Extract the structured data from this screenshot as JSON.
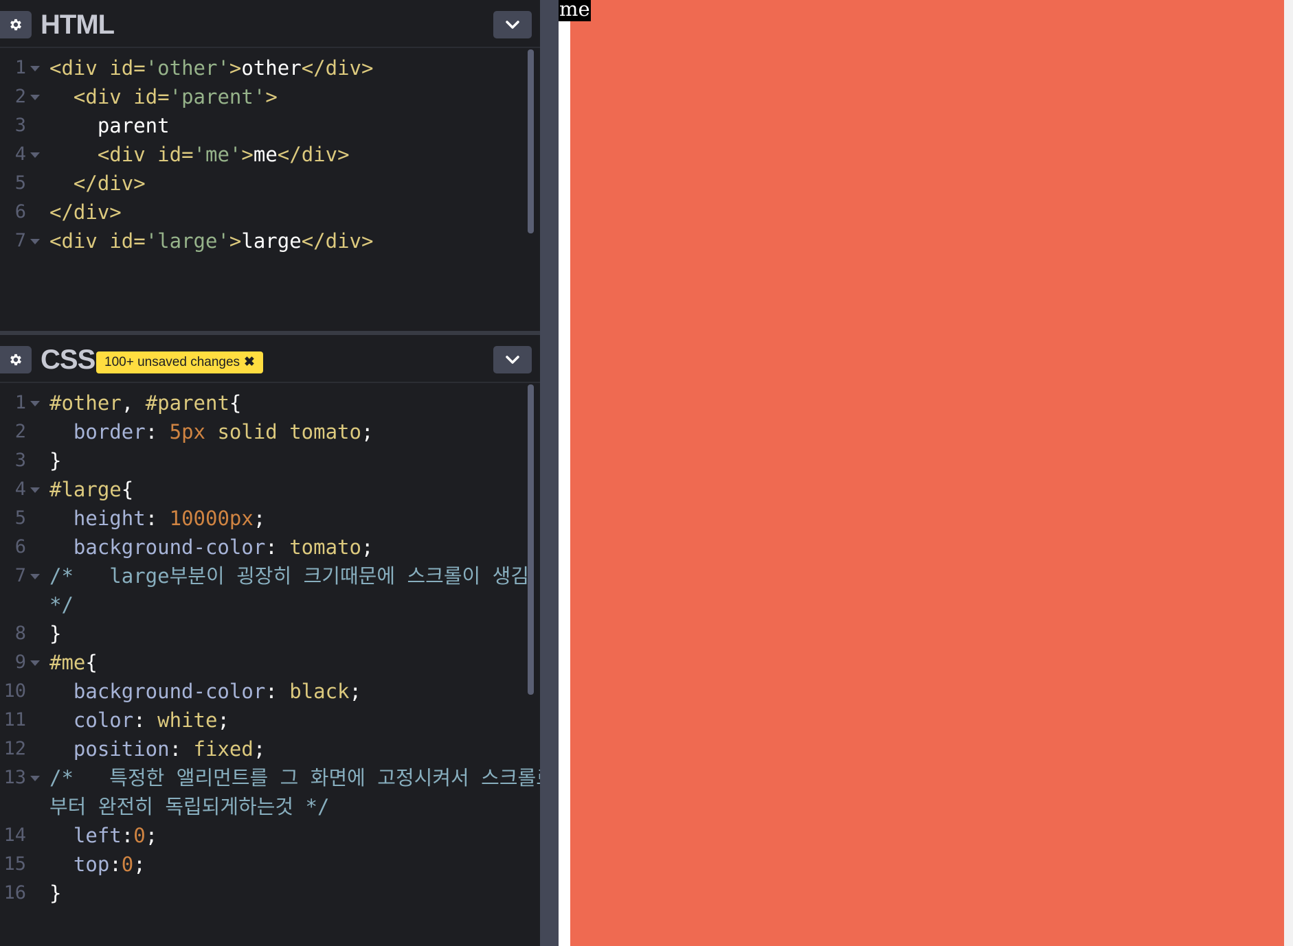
{
  "html_editor": {
    "title": "HTML",
    "settings_icon": "gear-icon",
    "collapse_icon": "chevron-down-icon",
    "lines": [
      {
        "n": "1",
        "fold": true,
        "indent": "",
        "tokens": [
          {
            "c": "tag",
            "t": "<div "
          },
          {
            "c": "attr",
            "t": "id="
          },
          {
            "c": "str",
            "t": "'other'"
          },
          {
            "c": "tag",
            "t": ">"
          },
          {
            "c": "txt",
            "t": "other"
          },
          {
            "c": "tag",
            "t": "</div>"
          }
        ]
      },
      {
        "n": "2",
        "fold": true,
        "indent": "  ",
        "tokens": [
          {
            "c": "tag",
            "t": "<div "
          },
          {
            "c": "attr",
            "t": "id="
          },
          {
            "c": "str",
            "t": "'parent'"
          },
          {
            "c": "tag",
            "t": ">"
          }
        ]
      },
      {
        "n": "3",
        "fold": false,
        "indent": "    ",
        "tokens": [
          {
            "c": "txt",
            "t": "parent"
          }
        ]
      },
      {
        "n": "4",
        "fold": true,
        "indent": "    ",
        "tokens": [
          {
            "c": "tag",
            "t": "<div "
          },
          {
            "c": "attr",
            "t": "id="
          },
          {
            "c": "str",
            "t": "'me'"
          },
          {
            "c": "tag",
            "t": ">"
          },
          {
            "c": "txt",
            "t": "me"
          },
          {
            "c": "tag",
            "t": "</div>"
          }
        ]
      },
      {
        "n": "5",
        "fold": false,
        "indent": "  ",
        "tokens": [
          {
            "c": "tag",
            "t": "</div>"
          }
        ]
      },
      {
        "n": "6",
        "fold": false,
        "indent": "",
        "tokens": [
          {
            "c": "tag",
            "t": "</div>"
          }
        ]
      },
      {
        "n": "7",
        "fold": true,
        "indent": "",
        "tokens": [
          {
            "c": "tag",
            "t": "<div "
          },
          {
            "c": "attr",
            "t": "id="
          },
          {
            "c": "str",
            "t": "'large'"
          },
          {
            "c": "tag",
            "t": ">"
          },
          {
            "c": "txt",
            "t": "large"
          },
          {
            "c": "tag",
            "t": "</div>"
          }
        ]
      }
    ]
  },
  "css_editor": {
    "title": "CSS",
    "settings_icon": "gear-icon",
    "collapse_icon": "chevron-down-icon",
    "badge_label": "100+ unsaved changes",
    "badge_icon": "close-icon",
    "lines": [
      {
        "n": "1",
        "fold": true,
        "indent": "",
        "tokens": [
          {
            "c": "sel",
            "t": "#other"
          },
          {
            "c": "punc",
            "t": ", "
          },
          {
            "c": "sel",
            "t": "#parent"
          },
          {
            "c": "punc",
            "t": "{"
          }
        ]
      },
      {
        "n": "2",
        "fold": false,
        "indent": "  ",
        "tokens": [
          {
            "c": "prop",
            "t": "border"
          },
          {
            "c": "punc",
            "t": ": "
          },
          {
            "c": "num",
            "t": "5px"
          },
          {
            "c": "val",
            "t": " solid tomato"
          },
          {
            "c": "punc",
            "t": ";"
          }
        ]
      },
      {
        "n": "3",
        "fold": false,
        "indent": "",
        "tokens": [
          {
            "c": "punc",
            "t": "}"
          }
        ]
      },
      {
        "n": "4",
        "fold": true,
        "indent": "",
        "tokens": [
          {
            "c": "sel",
            "t": "#large"
          },
          {
            "c": "punc",
            "t": "{"
          }
        ]
      },
      {
        "n": "5",
        "fold": false,
        "indent": "  ",
        "tokens": [
          {
            "c": "prop",
            "t": "height"
          },
          {
            "c": "punc",
            "t": ": "
          },
          {
            "c": "num",
            "t": "10000px"
          },
          {
            "c": "punc",
            "t": ";"
          }
        ]
      },
      {
        "n": "6",
        "fold": false,
        "indent": "  ",
        "tokens": [
          {
            "c": "prop",
            "t": "background-color"
          },
          {
            "c": "punc",
            "t": ": "
          },
          {
            "c": "val",
            "t": "tomato"
          },
          {
            "c": "punc",
            "t": ";"
          }
        ]
      },
      {
        "n": "7",
        "fold": true,
        "indent": "",
        "tokens": [
          {
            "c": "cmt",
            "t": "/*   large부분이 굉장히 크기때문에 스크롤이 생김"
          }
        ]
      },
      {
        "n": "",
        "fold": false,
        "indent": "",
        "tokens": [
          {
            "c": "cmt",
            "t": "*/"
          }
        ]
      },
      {
        "n": "8",
        "fold": false,
        "indent": "",
        "tokens": [
          {
            "c": "punc",
            "t": "}"
          }
        ]
      },
      {
        "n": "9",
        "fold": true,
        "indent": "",
        "tokens": [
          {
            "c": "sel",
            "t": "#me"
          },
          {
            "c": "punc",
            "t": "{"
          }
        ]
      },
      {
        "n": "10",
        "fold": false,
        "indent": "  ",
        "tokens": [
          {
            "c": "prop",
            "t": "background-color"
          },
          {
            "c": "punc",
            "t": ": "
          },
          {
            "c": "val",
            "t": "black"
          },
          {
            "c": "punc",
            "t": ";"
          }
        ]
      },
      {
        "n": "11",
        "fold": false,
        "indent": "  ",
        "tokens": [
          {
            "c": "prop",
            "t": "color"
          },
          {
            "c": "punc",
            "t": ": "
          },
          {
            "c": "val",
            "t": "white"
          },
          {
            "c": "punc",
            "t": ";"
          }
        ]
      },
      {
        "n": "12",
        "fold": false,
        "indent": "  ",
        "tokens": [
          {
            "c": "prop",
            "t": "position"
          },
          {
            "c": "punc",
            "t": ": "
          },
          {
            "c": "val",
            "t": "fixed"
          },
          {
            "c": "punc",
            "t": ";"
          }
        ]
      },
      {
        "n": "13",
        "fold": true,
        "indent": "",
        "tokens": [
          {
            "c": "cmt",
            "t": "/*   특정한 앨리먼트를 그 화면에 고정시켜서 스크롤로"
          }
        ]
      },
      {
        "n": "",
        "fold": false,
        "indent": "",
        "tokens": [
          {
            "c": "cmt",
            "t": "부터 완전히 독립되게하는것 */"
          }
        ]
      },
      {
        "n": "14",
        "fold": false,
        "indent": "  ",
        "tokens": [
          {
            "c": "prop",
            "t": "left"
          },
          {
            "c": "punc",
            "t": ":"
          },
          {
            "c": "num",
            "t": "0"
          },
          {
            "c": "punc",
            "t": ";"
          }
        ]
      },
      {
        "n": "15",
        "fold": false,
        "indent": "  ",
        "tokens": [
          {
            "c": "prop",
            "t": "top"
          },
          {
            "c": "punc",
            "t": ":"
          },
          {
            "c": "num",
            "t": "0"
          },
          {
            "c": "punc",
            "t": ";"
          }
        ]
      },
      {
        "n": "16",
        "fold": false,
        "indent": "",
        "tokens": [
          {
            "c": "punc",
            "t": "}"
          }
        ]
      }
    ]
  },
  "preview": {
    "me_text": "me",
    "large_color": "#ef6a51"
  },
  "colors": {
    "editor_bg": "#1d1e22",
    "badge": "#ffdd40",
    "tomato_render": "#ef6a51"
  }
}
